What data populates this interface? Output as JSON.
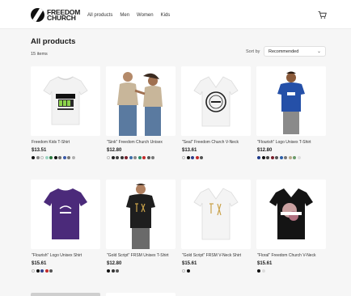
{
  "header": {
    "brand_line1": "FREEDOM",
    "brand_line2": "CHURCH",
    "nav": [
      "All products",
      "Men",
      "Women",
      "Kids"
    ],
    "cart_icon": "cart-icon"
  },
  "listing": {
    "title": "All products",
    "count": "15 items",
    "sort_label": "Sort by",
    "sort_value": "Recommended"
  },
  "products": [
    {
      "name": "Freedom Kids T-Shirt",
      "price": "$13.51",
      "colors": [
        "#111111",
        "#888888",
        "#ffffff",
        "#9bd3c1",
        "#2b7a3f",
        "#111111",
        "#6b6b6b",
        "#3b5aa8",
        "#777777",
        "#b0b0b0"
      ]
    },
    {
      "name": "\"Sink\" Freedom Church Unisex",
      "price": "$12.80",
      "colors": [
        "#ffffff",
        "#222222",
        "#444444",
        "#333333",
        "#7a1f2b",
        "#3c6ea8",
        "#888888",
        "#2a8c6b",
        "#c22a2a",
        "#555555",
        "#777777"
      ]
    },
    {
      "name": "\"Seal\" Freedom Church V-Neck",
      "price": "$13.61",
      "colors": [
        "#ffffff",
        "#111111",
        "#2e3e8a",
        "#c22a2a",
        "#555555"
      ]
    },
    {
      "name": "\"Flourish\" Logo Unisex T-Shirt",
      "price": "$12.80",
      "colors": [
        "#1f3a8a",
        "#111111",
        "#444444",
        "#7a1f2b",
        "#555555",
        "#2b5fa8",
        "#777777",
        "#b7a98a",
        "#6a9a6a",
        "#dddddd"
      ]
    },
    {
      "name": "\"Flourish\" Logo Unisex Shirt",
      "price": "$15.61",
      "colors": [
        "#ffffff",
        "#111111",
        "#2e3e8a",
        "#c22a2a",
        "#555555"
      ]
    },
    {
      "name": "\"Gold Script\" FRSM Unisex T-Shirt",
      "price": "$12.80",
      "colors": [
        "#111111",
        "#333333",
        "#555555"
      ]
    },
    {
      "name": "\"Gold Script\" FRSM V-Neck Shirt",
      "price": "$15.61",
      "colors": [
        "#ffffff",
        "#111111"
      ]
    },
    {
      "name": "\"Floral\" Freedom Church V-Neck",
      "price": "$15.61",
      "colors": [
        "#111111",
        "#dddddd"
      ]
    }
  ],
  "colors": {
    "background": "#f6f6f6",
    "card": "#ffffff",
    "text": "#1a1a1a"
  }
}
